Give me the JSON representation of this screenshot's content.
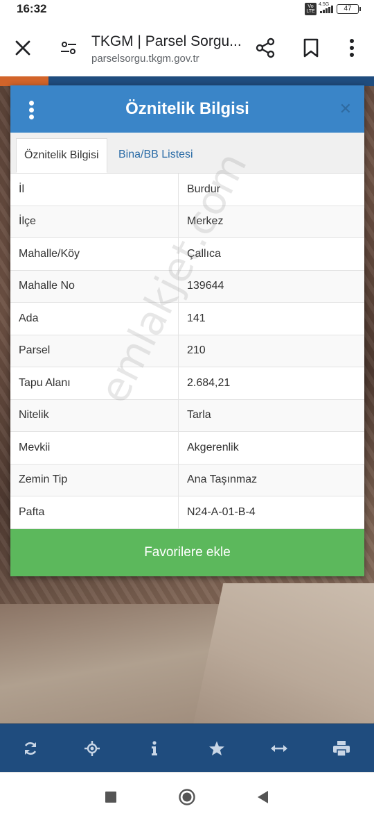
{
  "status_bar": {
    "time": "16:32",
    "network": "4.5G",
    "volte": "Vo LTE",
    "battery": "47"
  },
  "browser": {
    "title": "TKGM | Parsel Sorgu...",
    "url": "parselsorgu.tkgm.gov.tr"
  },
  "dialog": {
    "title": "Öznitelik Bilgisi",
    "close_glyph": "✕",
    "tabs": [
      {
        "label": "Öznitelik Bilgisi",
        "active": true
      },
      {
        "label": "Bina/BB Listesi",
        "active": false
      }
    ],
    "rows": [
      {
        "key": "İl",
        "value": "Burdur"
      },
      {
        "key": "İlçe",
        "value": "Merkez"
      },
      {
        "key": "Mahalle/Köy",
        "value": "Çallıca"
      },
      {
        "key": "Mahalle No",
        "value": "139644"
      },
      {
        "key": "Ada",
        "value": "141"
      },
      {
        "key": "Parsel",
        "value": "210"
      },
      {
        "key": "Tapu Alanı",
        "value": "2.684,21"
      },
      {
        "key": "Nitelik",
        "value": "Tarla"
      },
      {
        "key": "Mevkii",
        "value": "Akgerenlik"
      },
      {
        "key": "Zemin Tip",
        "value": "Ana Taşınmaz"
      },
      {
        "key": "Pafta",
        "value": "N24-A-01-B-4"
      }
    ],
    "favorite_button": "Favorilere ekle"
  },
  "watermark": "emlakjet.com",
  "map_toolbar": [
    "refresh-icon",
    "locate-icon",
    "info-icon",
    "star-icon",
    "measure-icon",
    "print-icon"
  ],
  "colors": {
    "header_blue": "#3a85c8",
    "tab_link": "#2a6ba6",
    "button_green": "#5cb85c",
    "map_toolbar": "#1f4c7e"
  }
}
